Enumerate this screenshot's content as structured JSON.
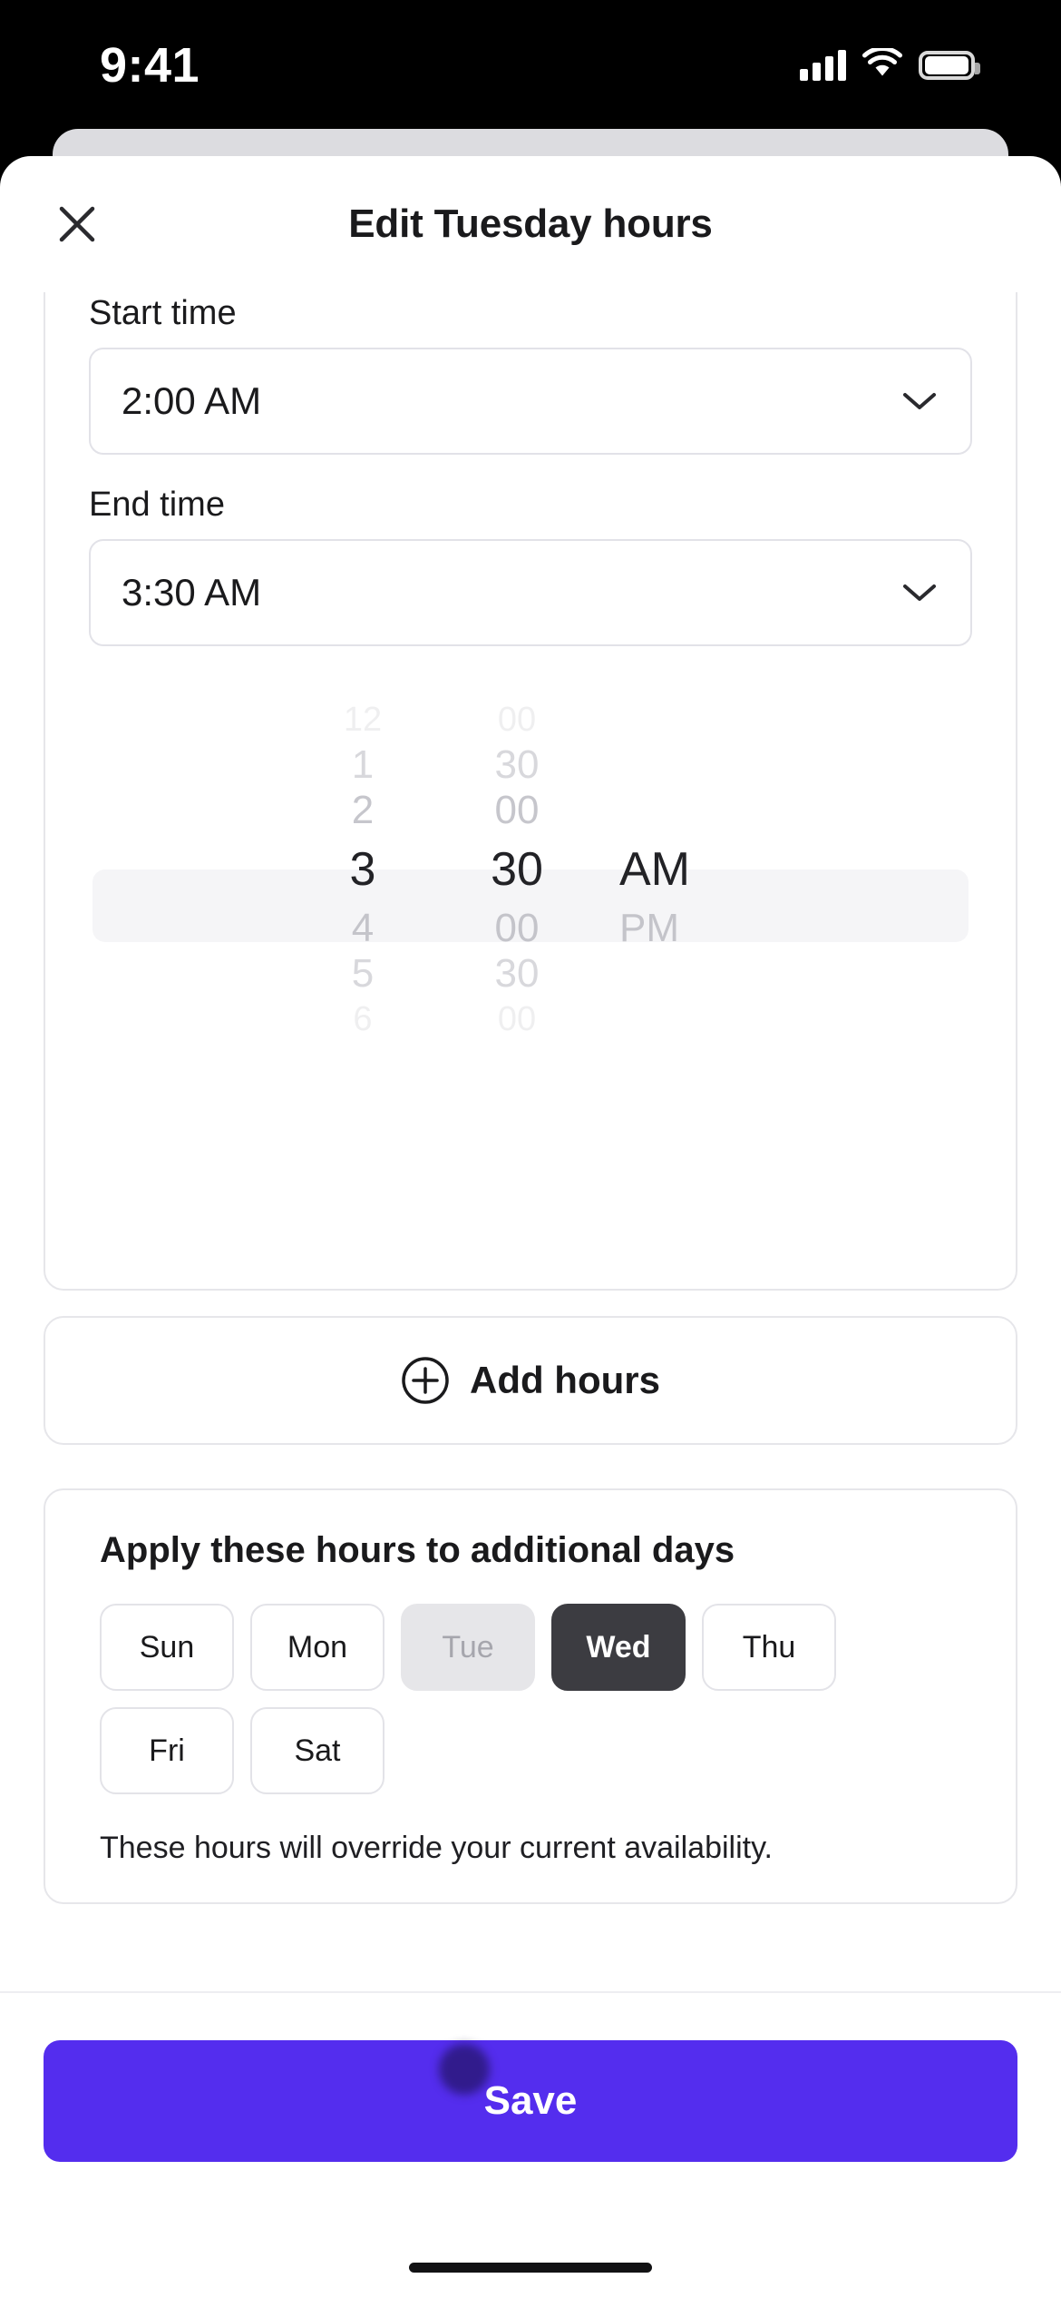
{
  "status_bar": {
    "time": "9:41",
    "signal_icon": "cellular-signal-icon",
    "wifi_icon": "wifi-icon",
    "battery_icon": "battery-icon"
  },
  "sheet": {
    "title": "Edit Tuesday hours",
    "close_icon": "close-icon"
  },
  "hours": {
    "start": {
      "label": "Start time",
      "value": "2:00 AM",
      "chevron_icon": "chevron-down-icon"
    },
    "end": {
      "label": "End time",
      "value": "3:30 AM",
      "chevron_icon": "chevron-down-icon"
    }
  },
  "picker": {
    "hours": [
      "12",
      "1",
      "2",
      "3",
      "4",
      "5",
      "6"
    ],
    "minutes": [
      "00",
      "30",
      "00",
      "30",
      "00",
      "30",
      "00"
    ],
    "meridiem": [
      "",
      "",
      "",
      "AM",
      "PM",
      "",
      ""
    ],
    "selected_index": 3,
    "selected_hour": "3",
    "selected_minute": "30",
    "selected_meridiem": "AM"
  },
  "add_hours": {
    "label": "Add hours",
    "icon": "plus-circle-icon"
  },
  "apply_days": {
    "title": "Apply these hours to additional days",
    "chips": [
      {
        "label": "Sun",
        "state": "default"
      },
      {
        "label": "Mon",
        "state": "default"
      },
      {
        "label": "Tue",
        "state": "disabled"
      },
      {
        "label": "Wed",
        "state": "selected"
      },
      {
        "label": "Thu",
        "state": "default"
      },
      {
        "label": "Fri",
        "state": "default"
      },
      {
        "label": "Sat",
        "state": "default"
      }
    ],
    "note": "These hours will override your current availability."
  },
  "footer": {
    "save_label": "Save",
    "save_color": "#542DEE"
  },
  "colors": {
    "accent": "#542DEE",
    "chip_selected_bg": "#3c3c41",
    "chip_disabled_bg": "#e6e6e9",
    "picker_highlight": "#f5f5f7",
    "text_primary": "#1a1a1c"
  }
}
